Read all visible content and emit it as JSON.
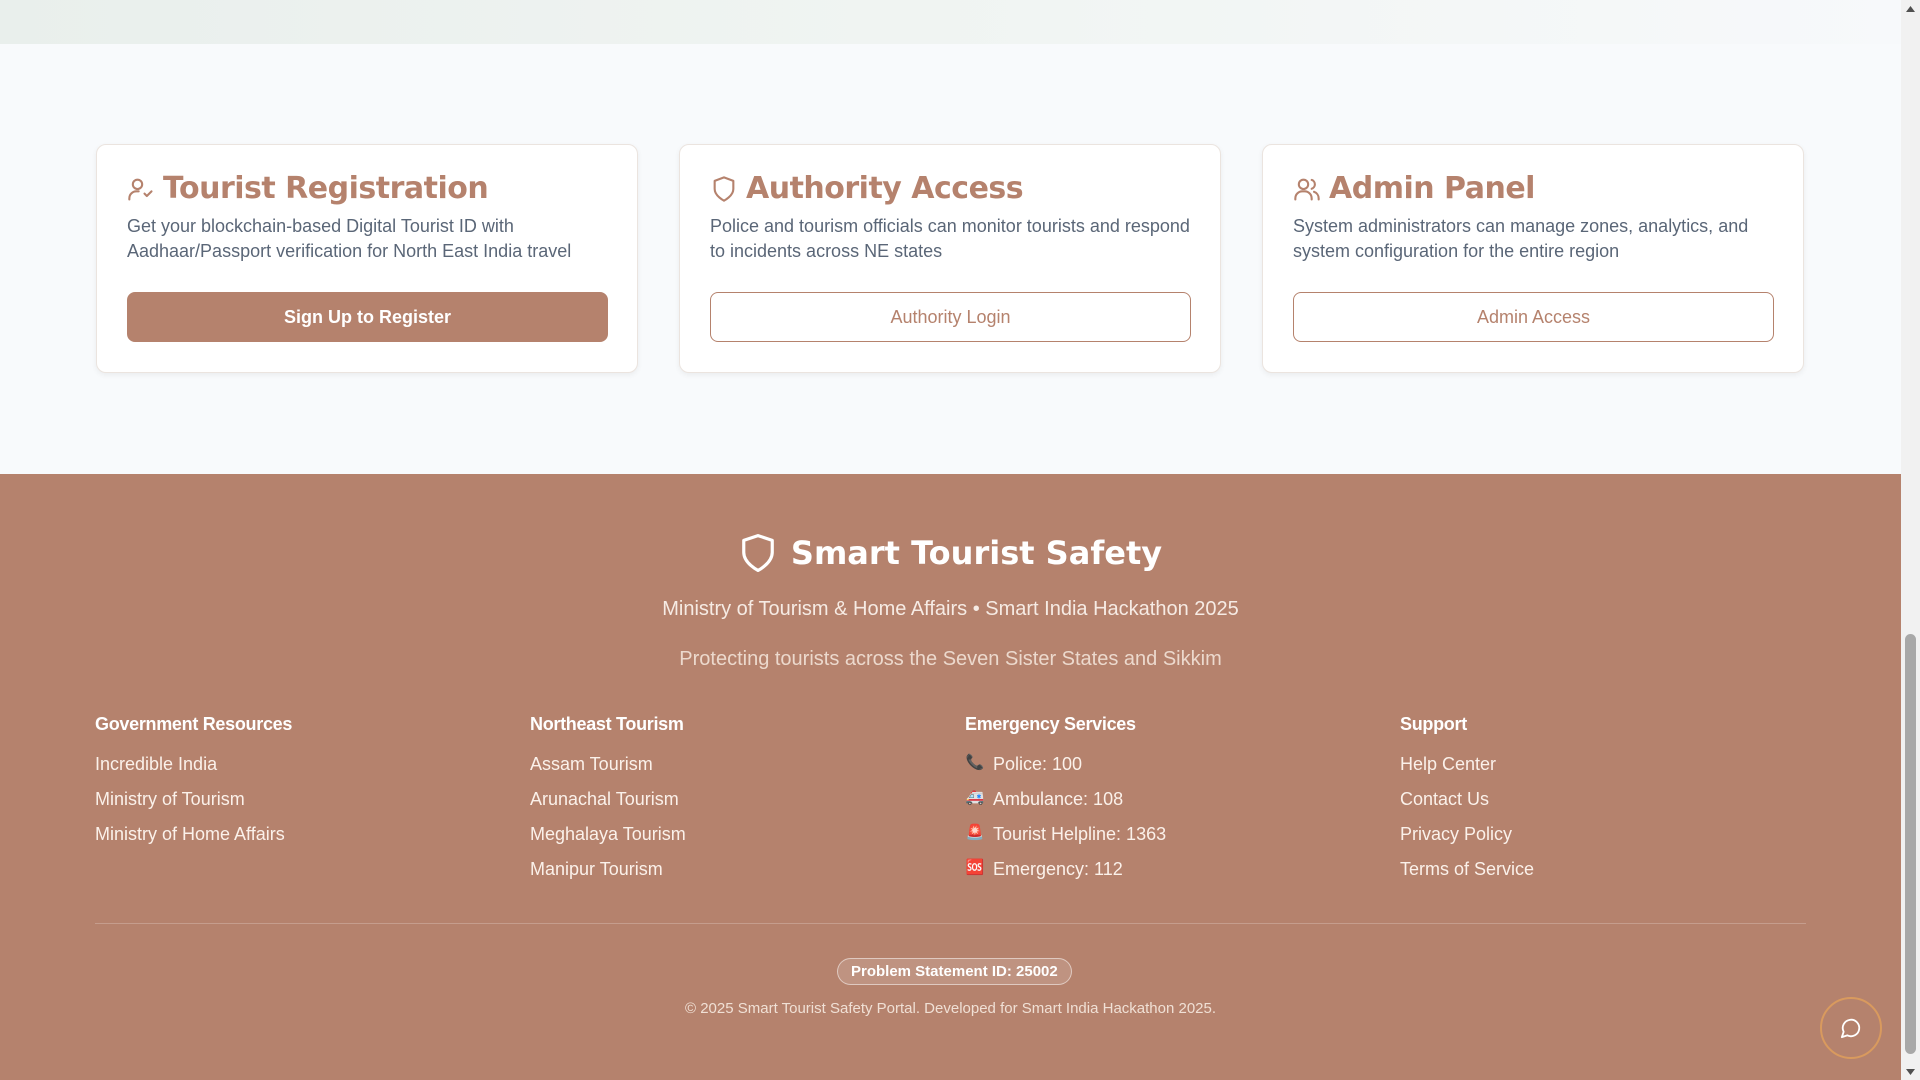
{
  "cards": [
    {
      "icon": "user-check-icon",
      "title": "Tourist Registration",
      "description": "Get your blockchain-based Digital Tourist ID with Aadhaar/Passport verification for North East India travel",
      "button": "Sign Up to Register"
    },
    {
      "icon": "shield-icon",
      "title": "Authority Access",
      "description": "Police and tourism officials can monitor tourists and respond to incidents across NE states",
      "button": "Authority Login"
    },
    {
      "icon": "users-icon",
      "title": "Admin Panel",
      "description": "System administrators can manage zones, analytics, and system configuration for the entire region",
      "button": "Admin Access"
    }
  ],
  "footer": {
    "brand_icon": "shield-icon",
    "brand": "Smart Tourist Safety",
    "ministry": "Ministry of Tourism & Home Affairs • Smart India Hackathon 2025",
    "tagline": "Protecting tourists across the Seven Sister States and Sikkim",
    "columns": [
      {
        "title": "Government Resources",
        "links": [
          "Incredible India",
          "Ministry of Tourism",
          "Ministry of Home Affairs"
        ]
      },
      {
        "title": "Northeast Tourism",
        "links": [
          "Assam Tourism",
          "Arunachal Tourism",
          "Meghalaya Tourism",
          "Manipur Tourism"
        ]
      },
      {
        "title": "Emergency Services",
        "items": [
          {
            "icon": "telephone-icon",
            "glyph": "📞",
            "text": "Police: 100"
          },
          {
            "icon": "ambulance-icon",
            "glyph": "🚑",
            "text": "Ambulance: 108"
          },
          {
            "icon": "siren-icon",
            "glyph": "🚨",
            "text": "Tourist Helpline: 1363"
          },
          {
            "icon": "sos-icon",
            "glyph": "🆘",
            "text": "Emergency: 112"
          }
        ]
      },
      {
        "title": "Support",
        "links": [
          "Help Center",
          "Contact Us",
          "Privacy Policy",
          "Terms of Service"
        ]
      }
    ],
    "badge": "Problem Statement ID: 25002",
    "copyright": "© 2025 Smart Tourist Safety Portal. Developed for Smart India Hackathon 2025."
  },
  "chat_icon": "chat-bubble-icon",
  "colors": {
    "accent": "#b5826d",
    "chat_ring": "#d99a5e",
    "description": "#5a6677"
  }
}
